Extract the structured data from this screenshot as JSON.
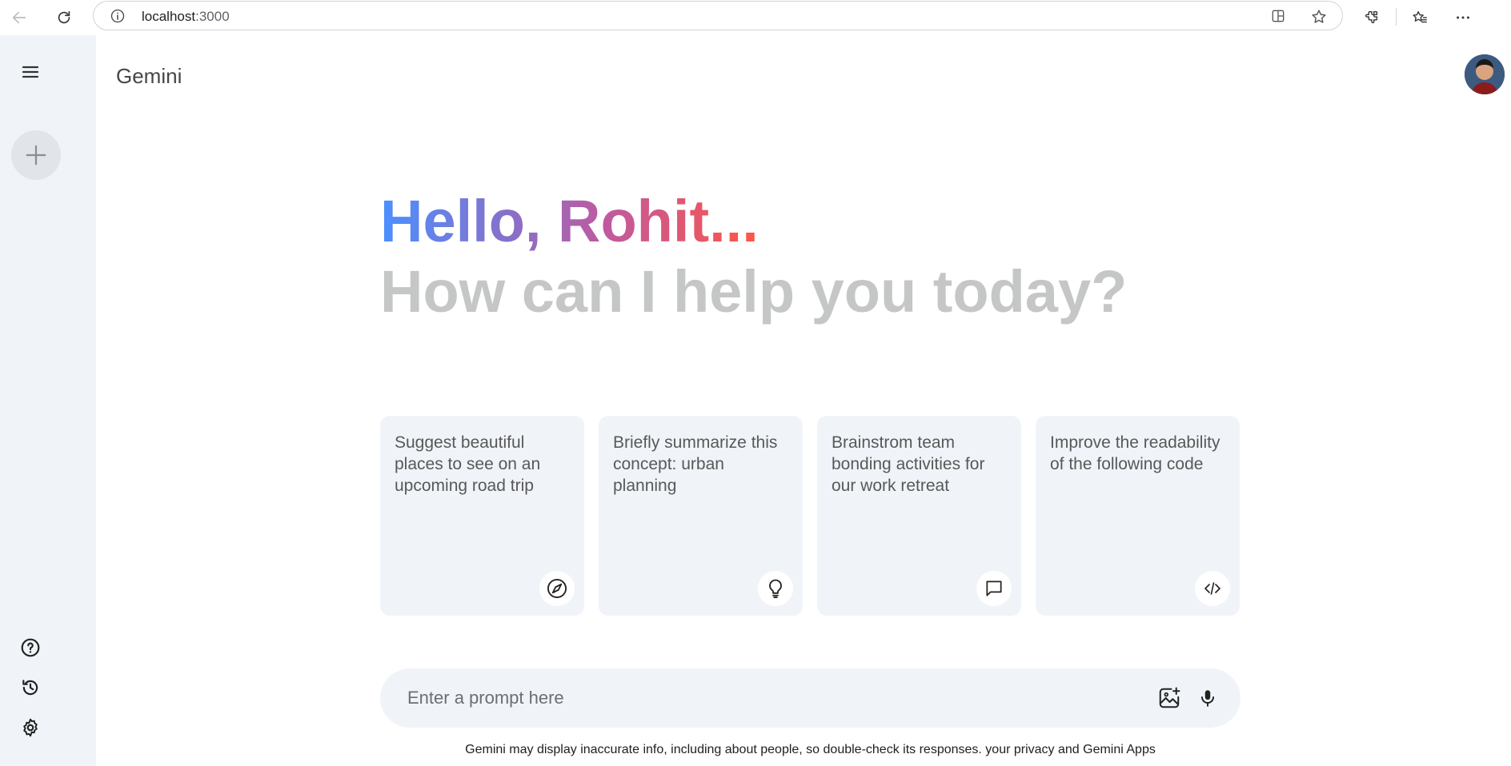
{
  "browser": {
    "url_host": "localhost",
    "url_port": ":3000",
    "icons": [
      "back-icon",
      "reload-icon",
      "info-icon",
      "split-screen-icon",
      "star-icon",
      "extensions-icon",
      "favorites-icon",
      "more-icon"
    ]
  },
  "app": {
    "title": "Gemini"
  },
  "sidebar": {
    "icons": [
      "menu-icon",
      "plus-icon",
      "help-icon",
      "history-icon",
      "settings-icon"
    ]
  },
  "greeting": {
    "hello": "Hello, Rohit...",
    "subtitle": "How can I help you today?"
  },
  "cards": [
    {
      "text": "Suggest beautiful places to see on an upcoming road trip",
      "icon": "compass-icon"
    },
    {
      "text": "Briefly summarize this concept: urban planning",
      "icon": "lightbulb-icon"
    },
    {
      "text": "Brainstrom team bonding activities for our work retreat",
      "icon": "message-icon"
    },
    {
      "text": "Improve the readability of the following code",
      "icon": "code-icon"
    }
  ],
  "prompt": {
    "placeholder": "Enter a prompt here",
    "value": "",
    "icons": [
      "image-add-icon",
      "mic-icon"
    ]
  },
  "footer": {
    "disclaimer": "Gemini may display inaccurate info, including about people, so double-check its responses. your privacy and Gemini Apps"
  },
  "colors": {
    "accent_start": "#4b90ff",
    "accent_end": "#ff5546",
    "sidebar_bg": "#f0f4f9",
    "subtitle": "#c4c7c5"
  }
}
